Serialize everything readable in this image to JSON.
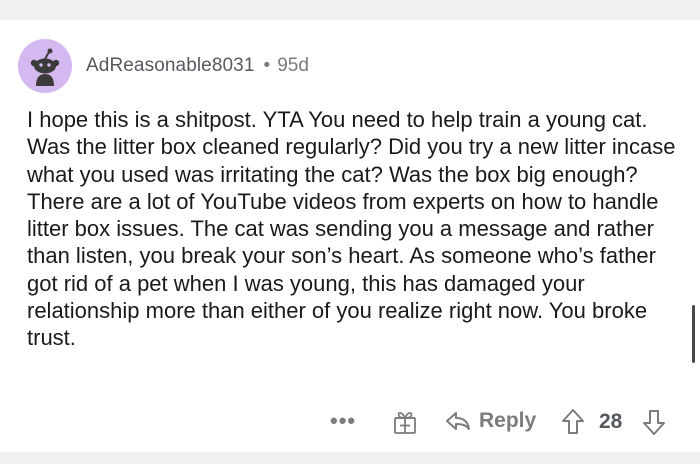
{
  "comment": {
    "username": "AdReasonable8031",
    "separator": "•",
    "age": "95d",
    "body": "I hope this is a shitpost. YTA You need to help train a young cat. Was the litter box cleaned regularly? Did you try a new litter incase what you used was irritating the cat?  Was the box big enough?  There are a lot of YouTube videos from experts on how to handle litter box issues. The cat was sending you a message and rather than listen, you break your son’s heart. As someone who’s father got rid of a pet when I was young, this has damaged your relationship more than either of you realize right now.  You broke trust.",
    "avatar_icon": "snoo-avatar-icon"
  },
  "actions": {
    "more_label": "•••",
    "more_icon": "more-options-icon",
    "gift_icon": "gift-award-icon",
    "reply_icon": "reply-arrow-icon",
    "reply_label": "Reply",
    "upvote_icon": "upvote-arrow-icon",
    "score": "28",
    "downvote_icon": "downvote-arrow-icon"
  },
  "colors": {
    "avatar_bg": "#d4b8f0",
    "page_band": "#eff0f2",
    "text": "#1a1a1b",
    "meta": "#7c7c7c"
  }
}
